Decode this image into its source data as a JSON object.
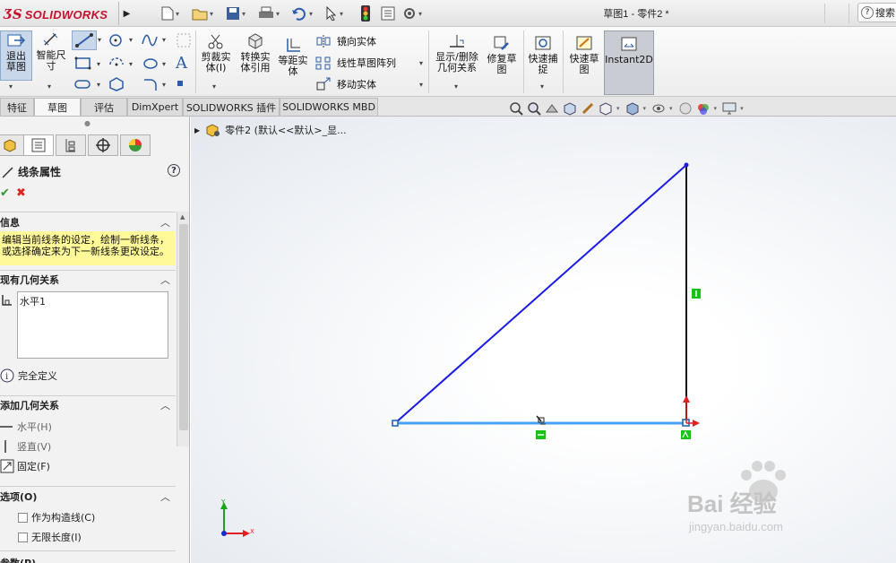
{
  "app": {
    "brand": "SOLIDWORKS",
    "document_title": "草图1 - 零件2 *",
    "search_label": "搜索"
  },
  "ribbon": {
    "exit_sketch": "退出草图",
    "smart_dimension": "智能尺寸",
    "trim": "剪裁实体(I)",
    "convert": "转换实体引用",
    "offset": "等距实体",
    "mirror": "镜向实体",
    "linear_pattern": "线性草图阵列",
    "move": "移动实体",
    "display_relations": "显示/删除几何关系",
    "repair_sketch": "修复草图",
    "quick_snaps": "快速捕捉",
    "rapid_sketch": "快速草图",
    "instant2d": "Instant2D"
  },
  "tabs": [
    "特征",
    "草图",
    "评估",
    "DimXpert",
    "SOLIDWORKS 插件",
    "SOLIDWORKS MBD"
  ],
  "active_tab": "草图",
  "panel": {
    "title": "线条属性",
    "info_header": "信息",
    "info_text_line1": "编辑当前线条的设定，绘制一新线条，",
    "info_text_line2": "或选择确定来为下一新线条更改设定。",
    "existing_header": "现有几何关系",
    "existing_item": "水平1",
    "status": "完全定义",
    "add_header": "添加几何关系",
    "add_horizontal": "水平(H)",
    "add_vertical": "竖直(V)",
    "add_fix": "固定(F)",
    "options_header": "选项(O)",
    "opt_construction": "作为构造线(C)",
    "opt_infinite": "无限长度(I)",
    "params_header": "参数(P)"
  },
  "tree": {
    "node": "零件2 (默认<<默认>_显..."
  },
  "axes": {
    "x": "X",
    "y": "Y"
  },
  "watermark": {
    "text": "Bai 经验",
    "url": "jingyan.baidu.com"
  },
  "colors": {
    "hypotenuse": "#1a1ae6",
    "base_selected": "#4aa3f0",
    "vertical_line": "#111111",
    "relation_badge": "#19c219",
    "origin_arrow": "#e02020",
    "info_bg": "#fff99a"
  }
}
